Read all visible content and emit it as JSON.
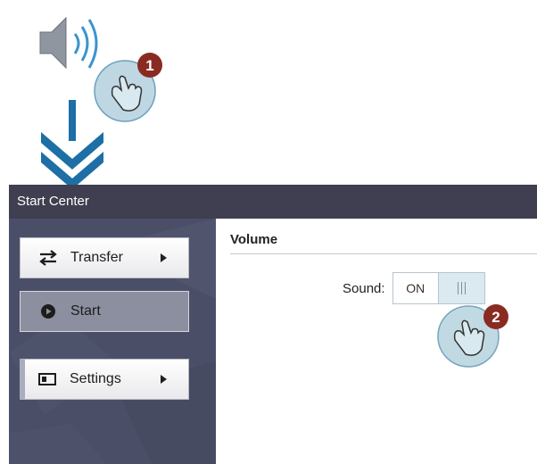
{
  "window": {
    "title": "Start Center"
  },
  "callouts": [
    {
      "number": "1"
    },
    {
      "number": "2"
    }
  ],
  "sidebar": {
    "items": [
      {
        "label": "Transfer",
        "icon": "swap-arrows-icon"
      },
      {
        "label": "Start",
        "icon": "play-circle-icon",
        "selected": true
      },
      {
        "label": "Settings",
        "icon": "settings-panel-icon"
      }
    ]
  },
  "main": {
    "section_title": "Volume",
    "sound": {
      "label": "Sound:",
      "toggle_text": "ON",
      "state": "on"
    }
  },
  "colors": {
    "accent": "#1d6fa5",
    "titlebar": "#3f3f51",
    "sidebar": "#4a4e67",
    "callout_badge": "#8a2b22",
    "hand_bubble": "#bed7e2"
  }
}
